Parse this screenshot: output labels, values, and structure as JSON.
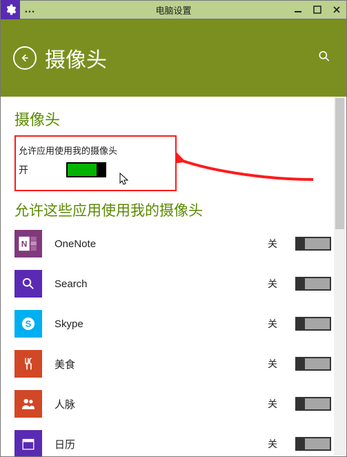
{
  "window": {
    "title": "电脑设置"
  },
  "header": {
    "title": "摄像头"
  },
  "main": {
    "section_main_title": "摄像头",
    "permission_label": "允许应用使用我的摄像头",
    "permission_state": "开",
    "apps_section_title": "允许这些应用使用我的摄像头"
  },
  "apps": [
    {
      "name": "OneNote",
      "state": "关"
    },
    {
      "name": "Search",
      "state": "关"
    },
    {
      "name": "Skype",
      "state": "关"
    },
    {
      "name": "美食",
      "state": "关"
    },
    {
      "name": "人脉",
      "state": "关"
    },
    {
      "name": "日历",
      "state": "关"
    }
  ]
}
